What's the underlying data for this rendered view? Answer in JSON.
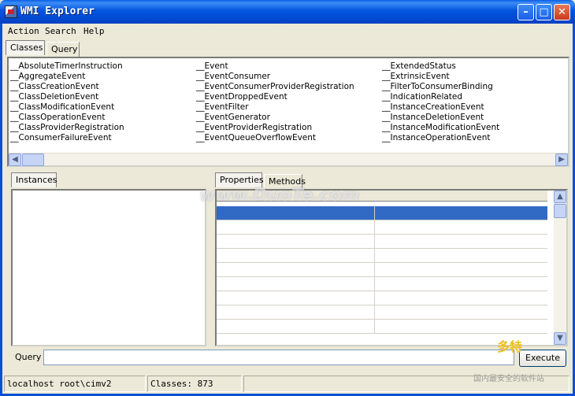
{
  "window": {
    "title": "WMI Explorer"
  },
  "menu": [
    "Action",
    "Search",
    "Help"
  ],
  "top_tabs": [
    {
      "label": "Classes",
      "active": true
    },
    {
      "label": "Query",
      "active": false
    }
  ],
  "classes": {
    "col1": [
      "__AbsoluteTimerInstruction",
      "__AggregateEvent",
      "__ClassCreationEvent",
      "__ClassDeletionEvent",
      "__ClassModificationEvent",
      "__ClassOperationEvent",
      "__ClassProviderRegistration",
      "__ConsumerFailureEvent"
    ],
    "col2": [
      "__Event",
      "__EventConsumer",
      "__EventConsumerProviderRegistration",
      "__EventDroppedEvent",
      "__EventFilter",
      "__EventGenerator",
      "__EventProviderRegistration",
      "__EventQueueOverflowEvent"
    ],
    "col3": [
      "__ExtendedStatus",
      "__ExtrinsicEvent",
      "__FilterToConsumerBinding",
      "__IndicationRelated",
      "__InstanceCreationEvent",
      "__InstanceDeletionEvent",
      "__InstanceModificationEvent",
      "__InstanceOperationEvent"
    ]
  },
  "instances_tab": "Instances",
  "detail_tabs": [
    {
      "label": "Properties",
      "active": true
    },
    {
      "label": "Methods",
      "active": false
    }
  ],
  "query": {
    "label": "Query",
    "value": "",
    "execute_label": "Execute"
  },
  "status": {
    "connection": "localhost  root\\cimv2",
    "classes": "Classes: 873"
  },
  "watermark": {
    "main": "www.DuoTe.com",
    "logo": "多特",
    "logo_sub": "国内最安全的软件站"
  },
  "colors": {
    "title_blue": "#0355e0",
    "selection": "#316ac5"
  }
}
